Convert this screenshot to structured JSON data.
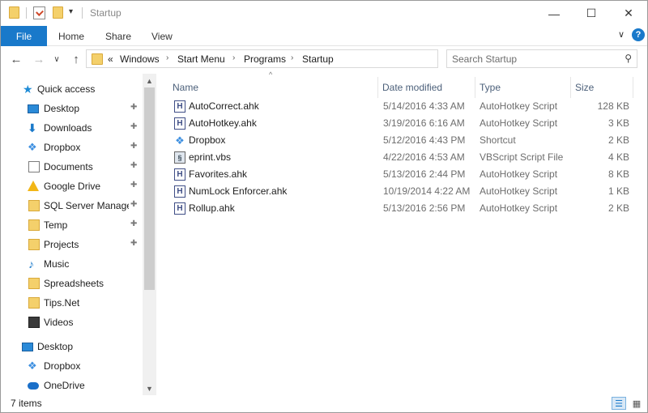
{
  "window": {
    "title": "Startup",
    "minimize_glyph": "—",
    "maximize_glyph": "☐",
    "close_glyph": "✕"
  },
  "quick_access_toolbar": {
    "icons": [
      "folder-icon",
      "properties-icon",
      "new-folder-icon"
    ],
    "dropdown_glyph": "▾"
  },
  "ribbon": {
    "tabs": [
      "File",
      "Home",
      "Share",
      "View"
    ],
    "expand_glyph": "∨",
    "help_glyph": "?"
  },
  "nav": {
    "back_glyph": "←",
    "forward_glyph": "→",
    "recent_glyph": "∨",
    "up_glyph": "↑"
  },
  "address": {
    "overflow": "«",
    "crumbs": [
      "Windows",
      "Start Menu",
      "Programs",
      "Startup"
    ],
    "separator": "›",
    "dropdown_glyph": "∨",
    "refresh_glyph": "↻"
  },
  "search": {
    "placeholder": "Search Startup",
    "icon": "⚲"
  },
  "sidebar": {
    "quick_access_label": "Quick access",
    "pin_glyph": "✚",
    "items": [
      {
        "label": "Desktop",
        "icon": "desktop-icon",
        "pinned": true
      },
      {
        "label": "Downloads",
        "icon": "downloads-icon",
        "pinned": true
      },
      {
        "label": "Dropbox",
        "icon": "dropbox-icon",
        "pinned": true
      },
      {
        "label": "Documents",
        "icon": "documents-icon",
        "pinned": true
      },
      {
        "label": "Google Drive",
        "icon": "google-drive-icon",
        "pinned": true
      },
      {
        "label": "SQL Server Managem",
        "icon": "folder-icon",
        "pinned": true
      },
      {
        "label": "Temp",
        "icon": "folder-icon",
        "pinned": true
      },
      {
        "label": "Projects",
        "icon": "folder-icon",
        "pinned": true
      },
      {
        "label": "Music",
        "icon": "music-icon",
        "pinned": false
      },
      {
        "label": "Spreadsheets",
        "icon": "folder-icon",
        "pinned": false
      },
      {
        "label": "Tips.Net",
        "icon": "folder-icon",
        "pinned": false
      },
      {
        "label": "Videos",
        "icon": "videos-icon",
        "pinned": false
      }
    ],
    "roots": [
      {
        "label": "Desktop",
        "icon": "desktop-icon"
      },
      {
        "label": "Dropbox",
        "icon": "dropbox-icon"
      },
      {
        "label": "OneDrive",
        "icon": "onedrive-icon"
      }
    ],
    "scroll_up_glyph": "▲",
    "scroll_down_glyph": "▼"
  },
  "file_list": {
    "sort_indicator": "^",
    "columns": {
      "name": "Name",
      "date": "Date modified",
      "type": "Type",
      "size": "Size"
    },
    "rows": [
      {
        "name": "AutoCorrect.ahk",
        "date": "5/14/2016 4:33 AM",
        "type": "AutoHotkey Script",
        "size": "128 KB",
        "icon": "ahk-script-icon"
      },
      {
        "name": "AutoHotkey.ahk",
        "date": "3/19/2016 6:16 AM",
        "type": "AutoHotkey Script",
        "size": "3 KB",
        "icon": "ahk-script-icon"
      },
      {
        "name": "Dropbox",
        "date": "5/12/2016 4:43 PM",
        "type": "Shortcut",
        "size": "2 KB",
        "icon": "dropbox-shortcut-icon"
      },
      {
        "name": "eprint.vbs",
        "date": "4/22/2016 4:53 AM",
        "type": "VBScript Script File",
        "size": "4 KB",
        "icon": "vbs-script-icon"
      },
      {
        "name": "Favorites.ahk",
        "date": "5/13/2016 2:44 PM",
        "type": "AutoHotkey Script",
        "size": "8 KB",
        "icon": "ahk-script-icon"
      },
      {
        "name": "NumLock Enforcer.ahk",
        "date": "10/19/2014 4:22 AM",
        "type": "AutoHotkey Script",
        "size": "1 KB",
        "icon": "ahk-script-icon"
      },
      {
        "name": "Rollup.ahk",
        "date": "5/13/2016 2:56 PM",
        "type": "AutoHotkey Script",
        "size": "2 KB",
        "icon": "ahk-script-icon"
      }
    ]
  },
  "status": {
    "item_count": "7 items"
  },
  "colors": {
    "accent": "#1979ca",
    "header_text": "#4c607a",
    "folder": "#f4d06b"
  }
}
